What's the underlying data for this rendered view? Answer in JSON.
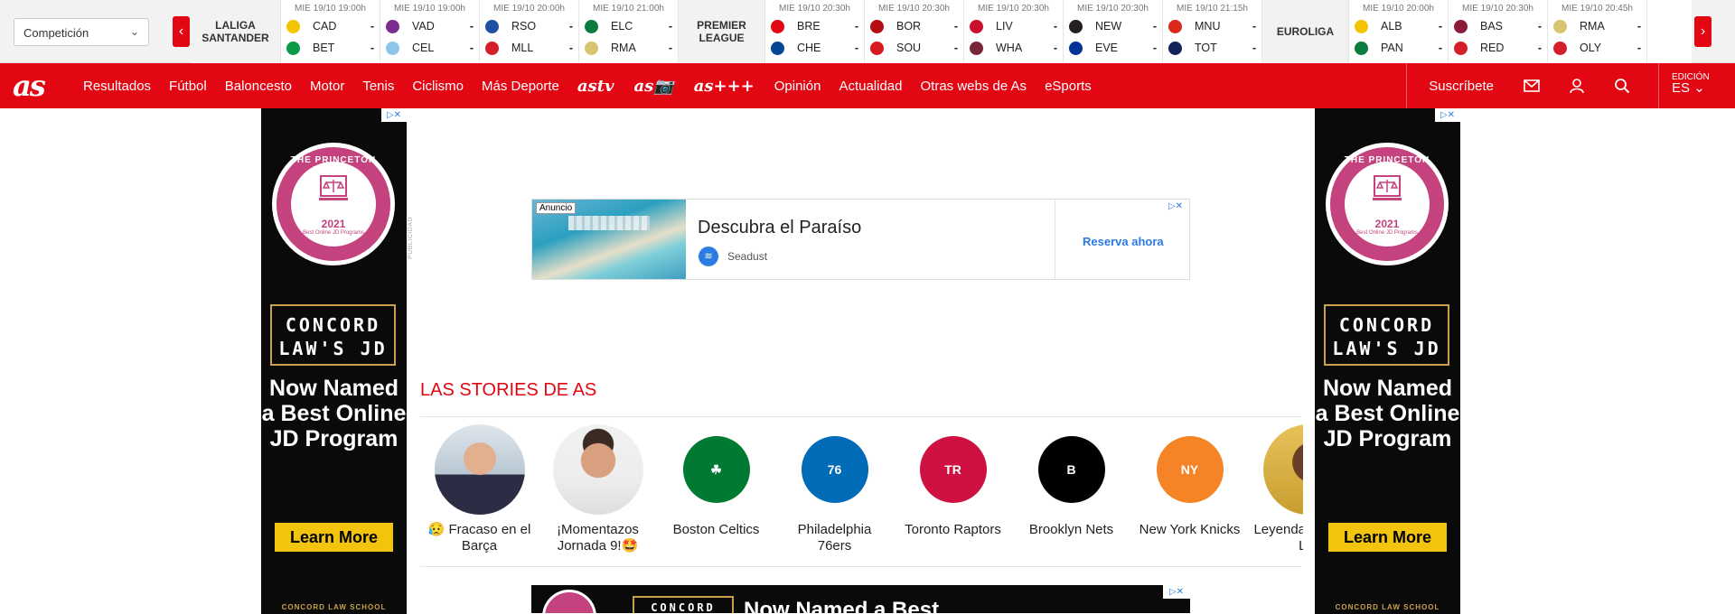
{
  "scorebar": {
    "competition_select": "Competición",
    "prev_label": "‹",
    "next_label": "›",
    "groups": [
      {
        "league": "LALIGA SANTANDER",
        "matches": [
          {
            "date": "MIE 19/10 19:00h",
            "home": "CAD",
            "away": "BET",
            "home_score": "-",
            "away_score": "-",
            "home_color": "#f5c400",
            "away_color": "#0b9b48"
          },
          {
            "date": "MIE 19/10 19:00h",
            "home": "VAD",
            "away": "CEL",
            "home_score": "-",
            "away_score": "-",
            "home_color": "#7b2c8e",
            "away_color": "#8cc6ea"
          },
          {
            "date": "MIE 19/10 20:00h",
            "home": "RSO",
            "away": "MLL",
            "home_score": "-",
            "away_score": "-",
            "home_color": "#1f4fa3",
            "away_color": "#d41f2b"
          },
          {
            "date": "MIE 19/10 21:00h",
            "home": "ELC",
            "away": "RMA",
            "home_score": "-",
            "away_score": "-",
            "home_color": "#0a7d3e",
            "away_color": "#d8c36e"
          }
        ]
      },
      {
        "league": "PREMIER LEAGUE",
        "matches": [
          {
            "date": "MIE 19/10 20:30h",
            "home": "BRE",
            "away": "CHE",
            "home_score": "-",
            "away_score": "-",
            "home_color": "#e30613",
            "away_color": "#034694"
          },
          {
            "date": "MIE 19/10 20:30h",
            "home": "BOR",
            "away": "SOU",
            "home_score": "-",
            "away_score": "-",
            "home_color": "#b50e12",
            "away_color": "#d71920"
          },
          {
            "date": "MIE 19/10 20:30h",
            "home": "LIV",
            "away": "WHA",
            "home_score": "-",
            "away_score": "-",
            "home_color": "#c8102e",
            "away_color": "#7a263a"
          },
          {
            "date": "MIE 19/10 20:30h",
            "home": "NEW",
            "away": "EVE",
            "home_score": "-",
            "away_score": "-",
            "home_color": "#241f20",
            "away_color": "#003399"
          },
          {
            "date": "MIE 19/10 21:15h",
            "home": "MNU",
            "away": "TOT",
            "home_score": "-",
            "away_score": "-",
            "home_color": "#da291c",
            "away_color": "#132257"
          }
        ]
      },
      {
        "league": "EUROLIGA",
        "matches": [
          {
            "date": "MIE 19/10 20:00h",
            "home": "ALB",
            "away": "PAN",
            "home_score": "-",
            "away_score": "-",
            "home_color": "#f5c400",
            "away_color": "#0a7d3e"
          },
          {
            "date": "MIE 19/10 20:30h",
            "home": "BAS",
            "away": "RED",
            "home_score": "-",
            "away_score": "-",
            "home_color": "#8b1d3a",
            "away_color": "#d41f2b"
          },
          {
            "date": "MIE 19/10 20:45h",
            "home": "RMA",
            "away": "OLY",
            "home_score": "-",
            "away_score": "-",
            "home_color": "#d8c36e",
            "away_color": "#d41f2b"
          }
        ]
      }
    ]
  },
  "nav": {
    "logo": "as",
    "items": [
      "Resultados",
      "Fútbol",
      "Baloncesto",
      "Motor",
      "Tenis",
      "Ciclismo",
      "Más Deporte"
    ],
    "brands": [
      "astv",
      "as📷",
      "as+++"
    ],
    "items2": [
      "Opinión",
      "Actualidad",
      "Otras webs de As",
      "eSports"
    ],
    "subscribe": "Suscríbete",
    "edition_label": "EDICIÓN",
    "edition_value": "ES"
  },
  "side_ad": {
    "adchoice": "▷✕",
    "badge_top": "THE PRINCETON REVIEW",
    "badge_year": "2021",
    "badge_sub": "Best Online JD Programs",
    "brand": "CONCORD LAW'S JD",
    "headline": "Now Named a Best Online JD Program",
    "cta": "Learn More",
    "footer": "CONCORD LAW SCHOOL"
  },
  "publicidad": "PUBLICIDAD",
  "top_ad": {
    "badge": "Anuncio",
    "title": "Descubra el Paraíso",
    "brand_icon": "≋",
    "brand": "Seadust",
    "cta": "Reserva ahora",
    "adchoice": "▷✕"
  },
  "stories": {
    "title": "LAS STORIES DE AS",
    "items": [
      {
        "label": "😥 Fracaso en el Barça",
        "thumb": "face"
      },
      {
        "label": "¡Momentazos Jornada 9!🤩",
        "thumb": "face2"
      },
      {
        "label": "Boston Celtics",
        "thumb": "logo",
        "color": "#007a33",
        "text": "☘"
      },
      {
        "label": "Philadelphia 76ers",
        "thumb": "logo",
        "color": "#006bb6",
        "text": "76"
      },
      {
        "label": "Toronto Raptors",
        "thumb": "logo",
        "color": "#ce1141",
        "text": "TR"
      },
      {
        "label": "Brooklyn Nets",
        "thumb": "logo",
        "color": "#000000",
        "text": "B"
      },
      {
        "label": "New York Knicks",
        "thumb": "logo",
        "color": "#f58426",
        "text": "NY"
      },
      {
        "label": "Leyenda... mate a L...",
        "thumb": "lebron"
      }
    ]
  },
  "bottom_ad": {
    "brand": "CONCORD",
    "headline": "Now Named a Best",
    "adchoice": "▷✕"
  }
}
